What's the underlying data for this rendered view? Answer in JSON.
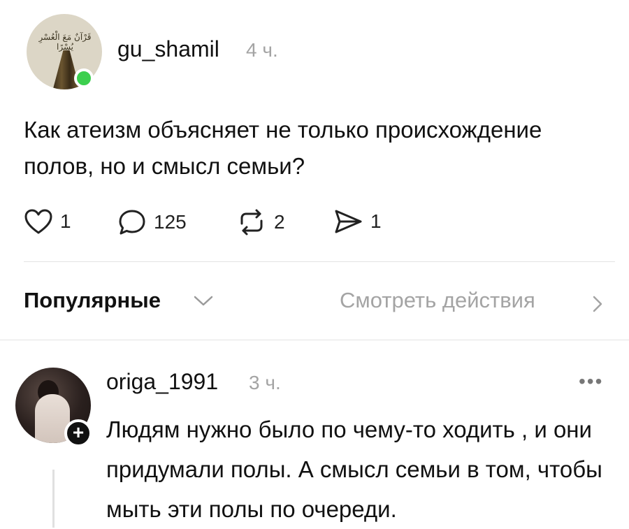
{
  "post": {
    "avatar_text": "قَرْآنٌ مَعَ الْعُسْرِ يُسْرًا",
    "username": "gu_shamil",
    "time": "4 ч.",
    "text": "Как атеизм объясняет не только происхождение полов, но и смысл семьи?",
    "actions": {
      "likes": "1",
      "comments": "125",
      "reposts": "2",
      "shares": "1"
    }
  },
  "sort": {
    "label": "Популярные",
    "activity_link": "Смотреть действия"
  },
  "comment": {
    "username": "origa_1991",
    "time": "3 ч.",
    "more": "•••",
    "text": "Людям нужно было по чему-то ходить , и они придумали полы. А смысл семьи в том, чтобы мыть эти полы по очереди.",
    "plus": "+"
  },
  "colors": {
    "online": "#3ccf4e",
    "muted": "#a4a4a4",
    "text": "#111111"
  }
}
